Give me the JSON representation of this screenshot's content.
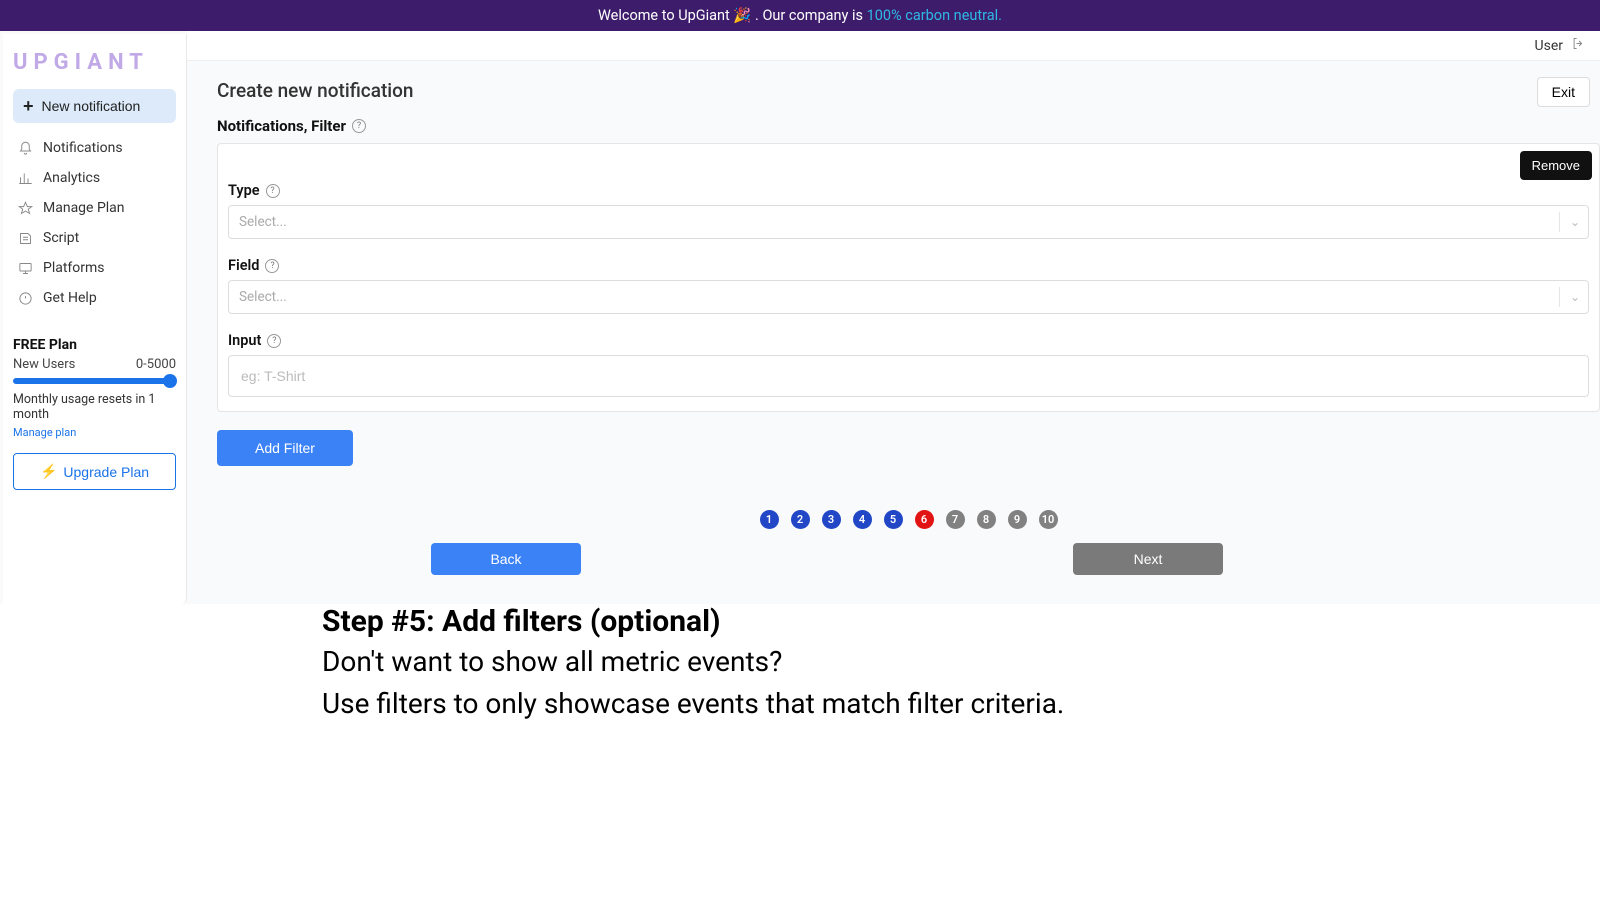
{
  "banner": {
    "prefix": "Welcome to UpGiant 🎉 . Our company is ",
    "link": "100% carbon neutral."
  },
  "brand": "UPGIANT",
  "sidebar": {
    "new_btn": "New notification",
    "items": [
      {
        "label": "Notifications"
      },
      {
        "label": "Analytics"
      },
      {
        "label": "Manage Plan"
      },
      {
        "label": "Script"
      },
      {
        "label": "Platforms"
      },
      {
        "label": "Get Help"
      }
    ],
    "plan": {
      "title": "FREE Plan",
      "metric": "New Users",
      "range": "0-5000",
      "reset": "Monthly usage resets in 1 month",
      "manage": "Manage plan",
      "upgrade": "Upgrade Plan"
    }
  },
  "topbar": {
    "user": "User"
  },
  "page": {
    "title": "Create new notification",
    "exit": "Exit",
    "section": "Notifications, Filter",
    "remove": "Remove",
    "type_label": "Type",
    "field_label": "Field",
    "input_label": "Input",
    "select_placeholder": "Select...",
    "input_placeholder": "eg: T-Shirt",
    "add_filter": "Add Filter",
    "back": "Back",
    "next": "Next"
  },
  "steps": {
    "labels": [
      "1",
      "2",
      "3",
      "4",
      "5",
      "6",
      "7",
      "8",
      "9",
      "10"
    ],
    "current": 6
  },
  "caption": {
    "title_bold": "Step #5: Add filters",
    "title_rest": " (optional)",
    "line1": "Don't want to show all metric events?",
    "line2": "Use filters to only showcase events that match filter criteria."
  }
}
